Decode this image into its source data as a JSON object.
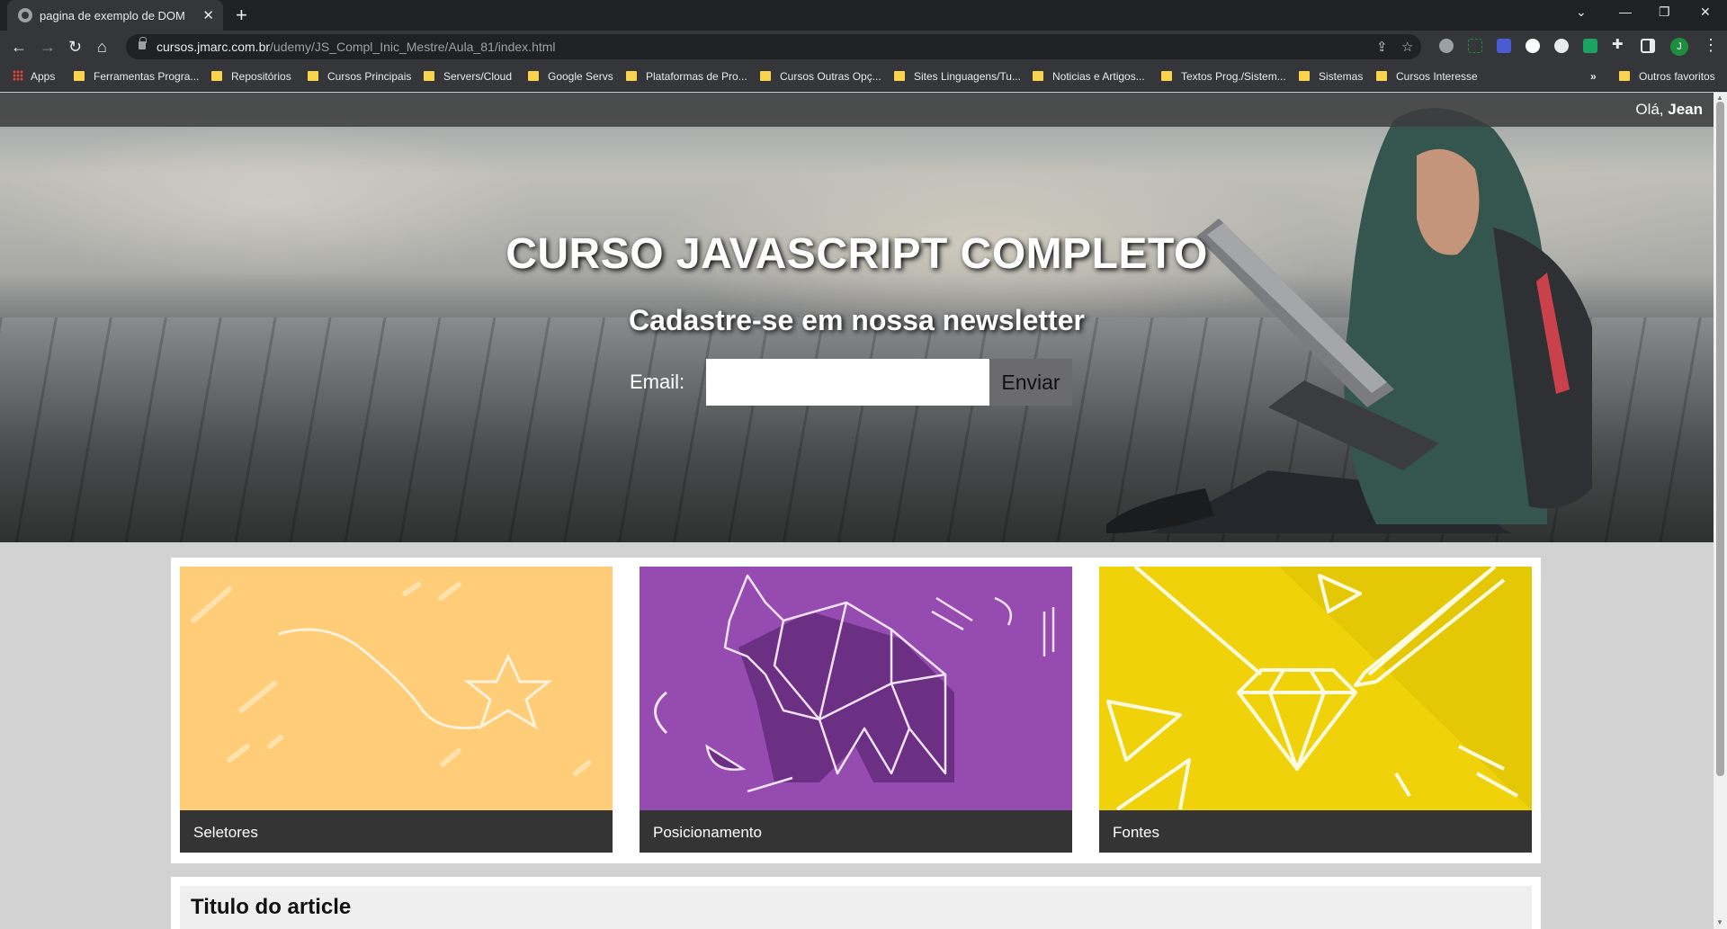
{
  "browser": {
    "tab_title": "pagina de exemplo de DOM",
    "url_host": "cursos.jmarc.com.br",
    "url_path": "/udemy/JS_Compl_Inic_Mestre/Aula_81/index.html",
    "profile_initial": "J",
    "bookmarks": [
      "Apps",
      "Ferramentas Progra...",
      "Repositórios",
      "Cursos Principais",
      "Servers/Cloud",
      "Google Servs",
      "Plataformas de Pro...",
      "Cursos Outras Opç...",
      "Sites Linguagens/Tu...",
      "Noticias e Artigos...",
      "Textos Prog./Sistem...",
      "Sistemas",
      "Cursos Interesse"
    ],
    "bookmarks_overflow": "»",
    "other_bookmarks": "Outros favoritos"
  },
  "page": {
    "greeting_prefix": "Olá, ",
    "user_name": "Jean",
    "hero_title": "CURSO JAVASCRIPT COMPLETO",
    "hero_subtitle": "Cadastre-se em nossa newsletter",
    "email_label": "Email:",
    "email_value": "",
    "submit_label": "Enviar",
    "cards": [
      {
        "label": "Seletores",
        "color": "#ffcc77"
      },
      {
        "label": "Posicionamento",
        "color": "#954bb0"
      },
      {
        "label": "Fontes",
        "color": "#efd20a"
      }
    ],
    "article_title": "Titulo do article"
  }
}
